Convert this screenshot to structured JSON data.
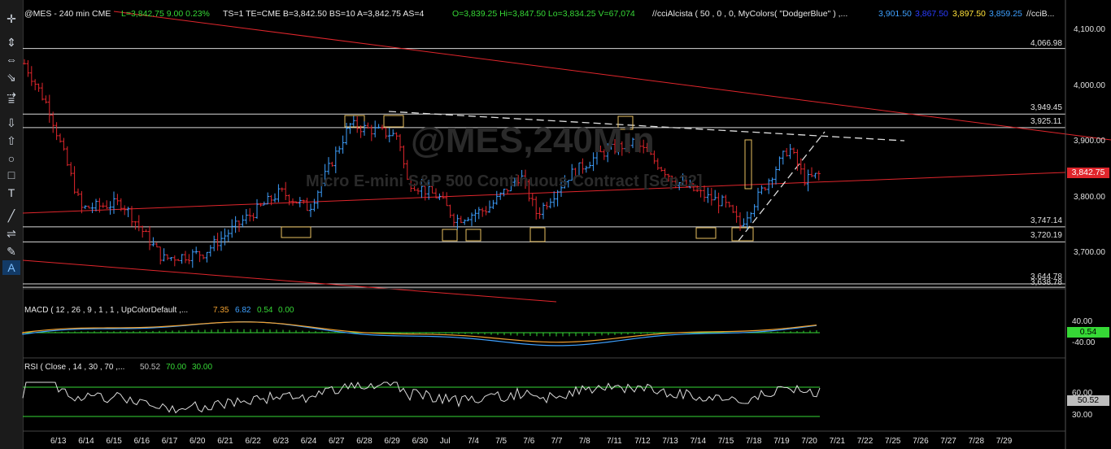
{
  "toolbar": {
    "icons": [
      "crosshair-icon",
      "cursor-move-icon",
      "horizontal-line-icon",
      "ruler-icon",
      "pen-icon",
      "lines-icon",
      "down-arrow-icon",
      "up-arrow-icon",
      "ellipse-icon",
      "rectangle-icon",
      "text-tool-icon",
      "trendline-icon",
      "fib-icon",
      "brush-icon",
      "annotation-icon"
    ],
    "glyphs": [
      "✛",
      "⇕",
      "⇔",
      "⇘",
      "⇢",
      "≡",
      "⇩",
      "⇧",
      "○",
      "□",
      "T",
      "╱",
      "⇌",
      "✎",
      "A"
    ]
  },
  "header": {
    "symbol": "@MES - 240 min  CME",
    "last": "L=3,842.75  9.00  0.23%",
    "info": "TS=1  TE=CME  B=3,842.50  BS=10  A=3,842.75  AS=4",
    "ohlc": "O=3,839.25  Hi=3,847.50  Lo=3,834.25  V=67,074",
    "study": "//cciAlcista ( 50 , 0 , 0, MyColors( \"DodgerBlue\" ) ,...",
    "v1": "3,901.50",
    "v2": "3,867.50",
    "v3": "3,897.50",
    "v4": "3,859.25",
    "tail": "//cciB..."
  },
  "watermark": {
    "symbol": "@MES,240Min",
    "name": "Micro E-mini S&P 500 Continuous Contract [Sep22]"
  },
  "price_axis": [
    "4,100.00",
    "4,000.00",
    "3,900.00",
    "3,800.00",
    "3,700.00"
  ],
  "last_price": "3,842.75",
  "levels": [
    "4,066.98",
    "3,949.45",
    "3,925.11",
    "3,747.14",
    "3,720.19",
    "3,644.78",
    "3,638.78"
  ],
  "macd": {
    "label": "MACD ( 12 , 26 , 9 , 1 , 1 , UpColorDefault ,...",
    "v1": "7.35",
    "v2": "6.82",
    "v3": "0.54",
    "v4": "0.00",
    "axis": [
      "40.00",
      "-40.00"
    ],
    "current": "0.54"
  },
  "rsi": {
    "label": "RSI ( Close , 14 , 30 , 70 ,...",
    "v1": "50.52",
    "v2": "70.00",
    "v3": "30.00",
    "axis": [
      "60.00",
      "30.00"
    ],
    "current": "50.52"
  },
  "dates": [
    "6/13",
    "6/14",
    "6/15",
    "6/16",
    "6/17",
    "6/20",
    "6/21",
    "6/22",
    "6/23",
    "6/24",
    "6/27",
    "6/28",
    "6/29",
    "6/30",
    "Jul",
    "7/4",
    "7/5",
    "7/6",
    "7/7",
    "7/8",
    "7/11",
    "7/12",
    "7/13",
    "7/14",
    "7/15",
    "7/18",
    "7/19",
    "7/20",
    "7/21",
    "7/22",
    "7/25",
    "7/26",
    "7/27",
    "7/28",
    "7/29"
  ],
  "colors": {
    "up": "#3ea0ff",
    "down": "#e0262c",
    "trend": "#e0262c",
    "level": "#d8d8d8",
    "accent": "#123a66",
    "box": "#e8c060"
  }
}
